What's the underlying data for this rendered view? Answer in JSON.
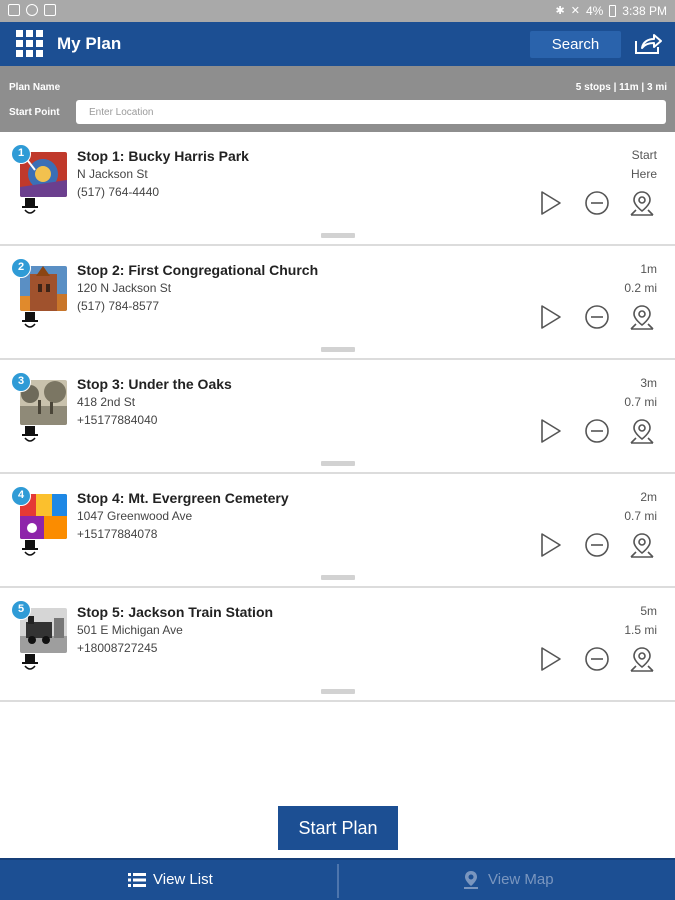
{
  "status_bar": {
    "battery": "4%",
    "time": "3:38 PM"
  },
  "app_bar": {
    "title": "My Plan",
    "search_label": "Search"
  },
  "plan": {
    "name_label": "Plan Name",
    "summary": "5 stops | 11m | 3 mi",
    "start_label": "Start Point",
    "start_placeholder": "Enter Location",
    "start_value": ""
  },
  "stops": [
    {
      "number": "1",
      "title": "Stop 1: Bucky Harris Park",
      "address": "N Jackson St",
      "phone": "(517) 764-4440",
      "time": "Start",
      "distance": "Here"
    },
    {
      "number": "2",
      "title": "Stop 2: First Congregational Church",
      "address": "120 N Jackson St",
      "phone": "(517) 784-8577",
      "time": "1m",
      "distance": "0.2 mi"
    },
    {
      "number": "3",
      "title": "Stop 3: Under the Oaks",
      "address": "418 2nd St",
      "phone": "+15177884040",
      "time": "3m",
      "distance": "0.7 mi"
    },
    {
      "number": "4",
      "title": "Stop 4: Mt. Evergreen Cemetery",
      "address": "1047 Greenwood Ave",
      "phone": "+15177884078",
      "time": "2m",
      "distance": "0.7 mi"
    },
    {
      "number": "5",
      "title": "Stop 5: Jackson Train Station",
      "address": "501 E Michigan Ave",
      "phone": "+18008727245",
      "time": "5m",
      "distance": "1.5 mi"
    }
  ],
  "start_plan_label": "Start Plan",
  "bottom_nav": {
    "list_label": "View List",
    "map_label": "View Map"
  },
  "colors": {
    "primary": "#1c4f93",
    "badge": "#2f9bd6",
    "header_gray": "#8e8e8e",
    "status_gray": "#a9a9a9"
  }
}
